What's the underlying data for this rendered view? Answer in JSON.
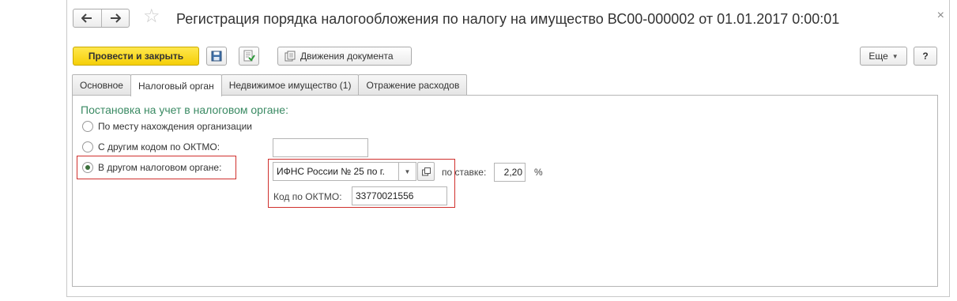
{
  "window": {
    "title": "Регистрация порядка налогообложения по налогу на имущество ВС00-000002 от 01.01.2017 0:00:01",
    "close_glyph": "×",
    "back_glyph": "🡐",
    "forward_glyph": "🡒",
    "favorite_glyph": "☆"
  },
  "toolbar": {
    "post_close_label": "Провести и закрыть",
    "movements_label": "Движения документа",
    "more_label": "Еще",
    "help_label": "?",
    "save_icon": "save-icon",
    "post_icon": "post-document-icon"
  },
  "tabs": [
    {
      "label": "Основное"
    },
    {
      "label": "Налоговый орган"
    },
    {
      "label": "Недвижимое имущество (1)"
    },
    {
      "label": "Отражение расходов"
    }
  ],
  "form": {
    "section_title": "Постановка на учет в налоговом органе:",
    "options": [
      {
        "label": "По месту нахождения организации",
        "checked": false
      },
      {
        "label": "С другим кодом по ОКТМО:",
        "checked": false
      },
      {
        "label": "В другом налоговом органе:",
        "checked": true
      }
    ],
    "oktmo_other_value": "",
    "tax_authority_value": "ИФНС России № 25 по г.",
    "rate_label": "по ставке:",
    "rate_value": "2,20",
    "percent_sign": "%",
    "oktmo_label": "Код по ОКТМО:",
    "oktmo_value": "33770021556"
  },
  "colors": {
    "primary_button": "#f5cf07",
    "section_title": "#3a8a63",
    "highlight_box": "#d0302d"
  }
}
